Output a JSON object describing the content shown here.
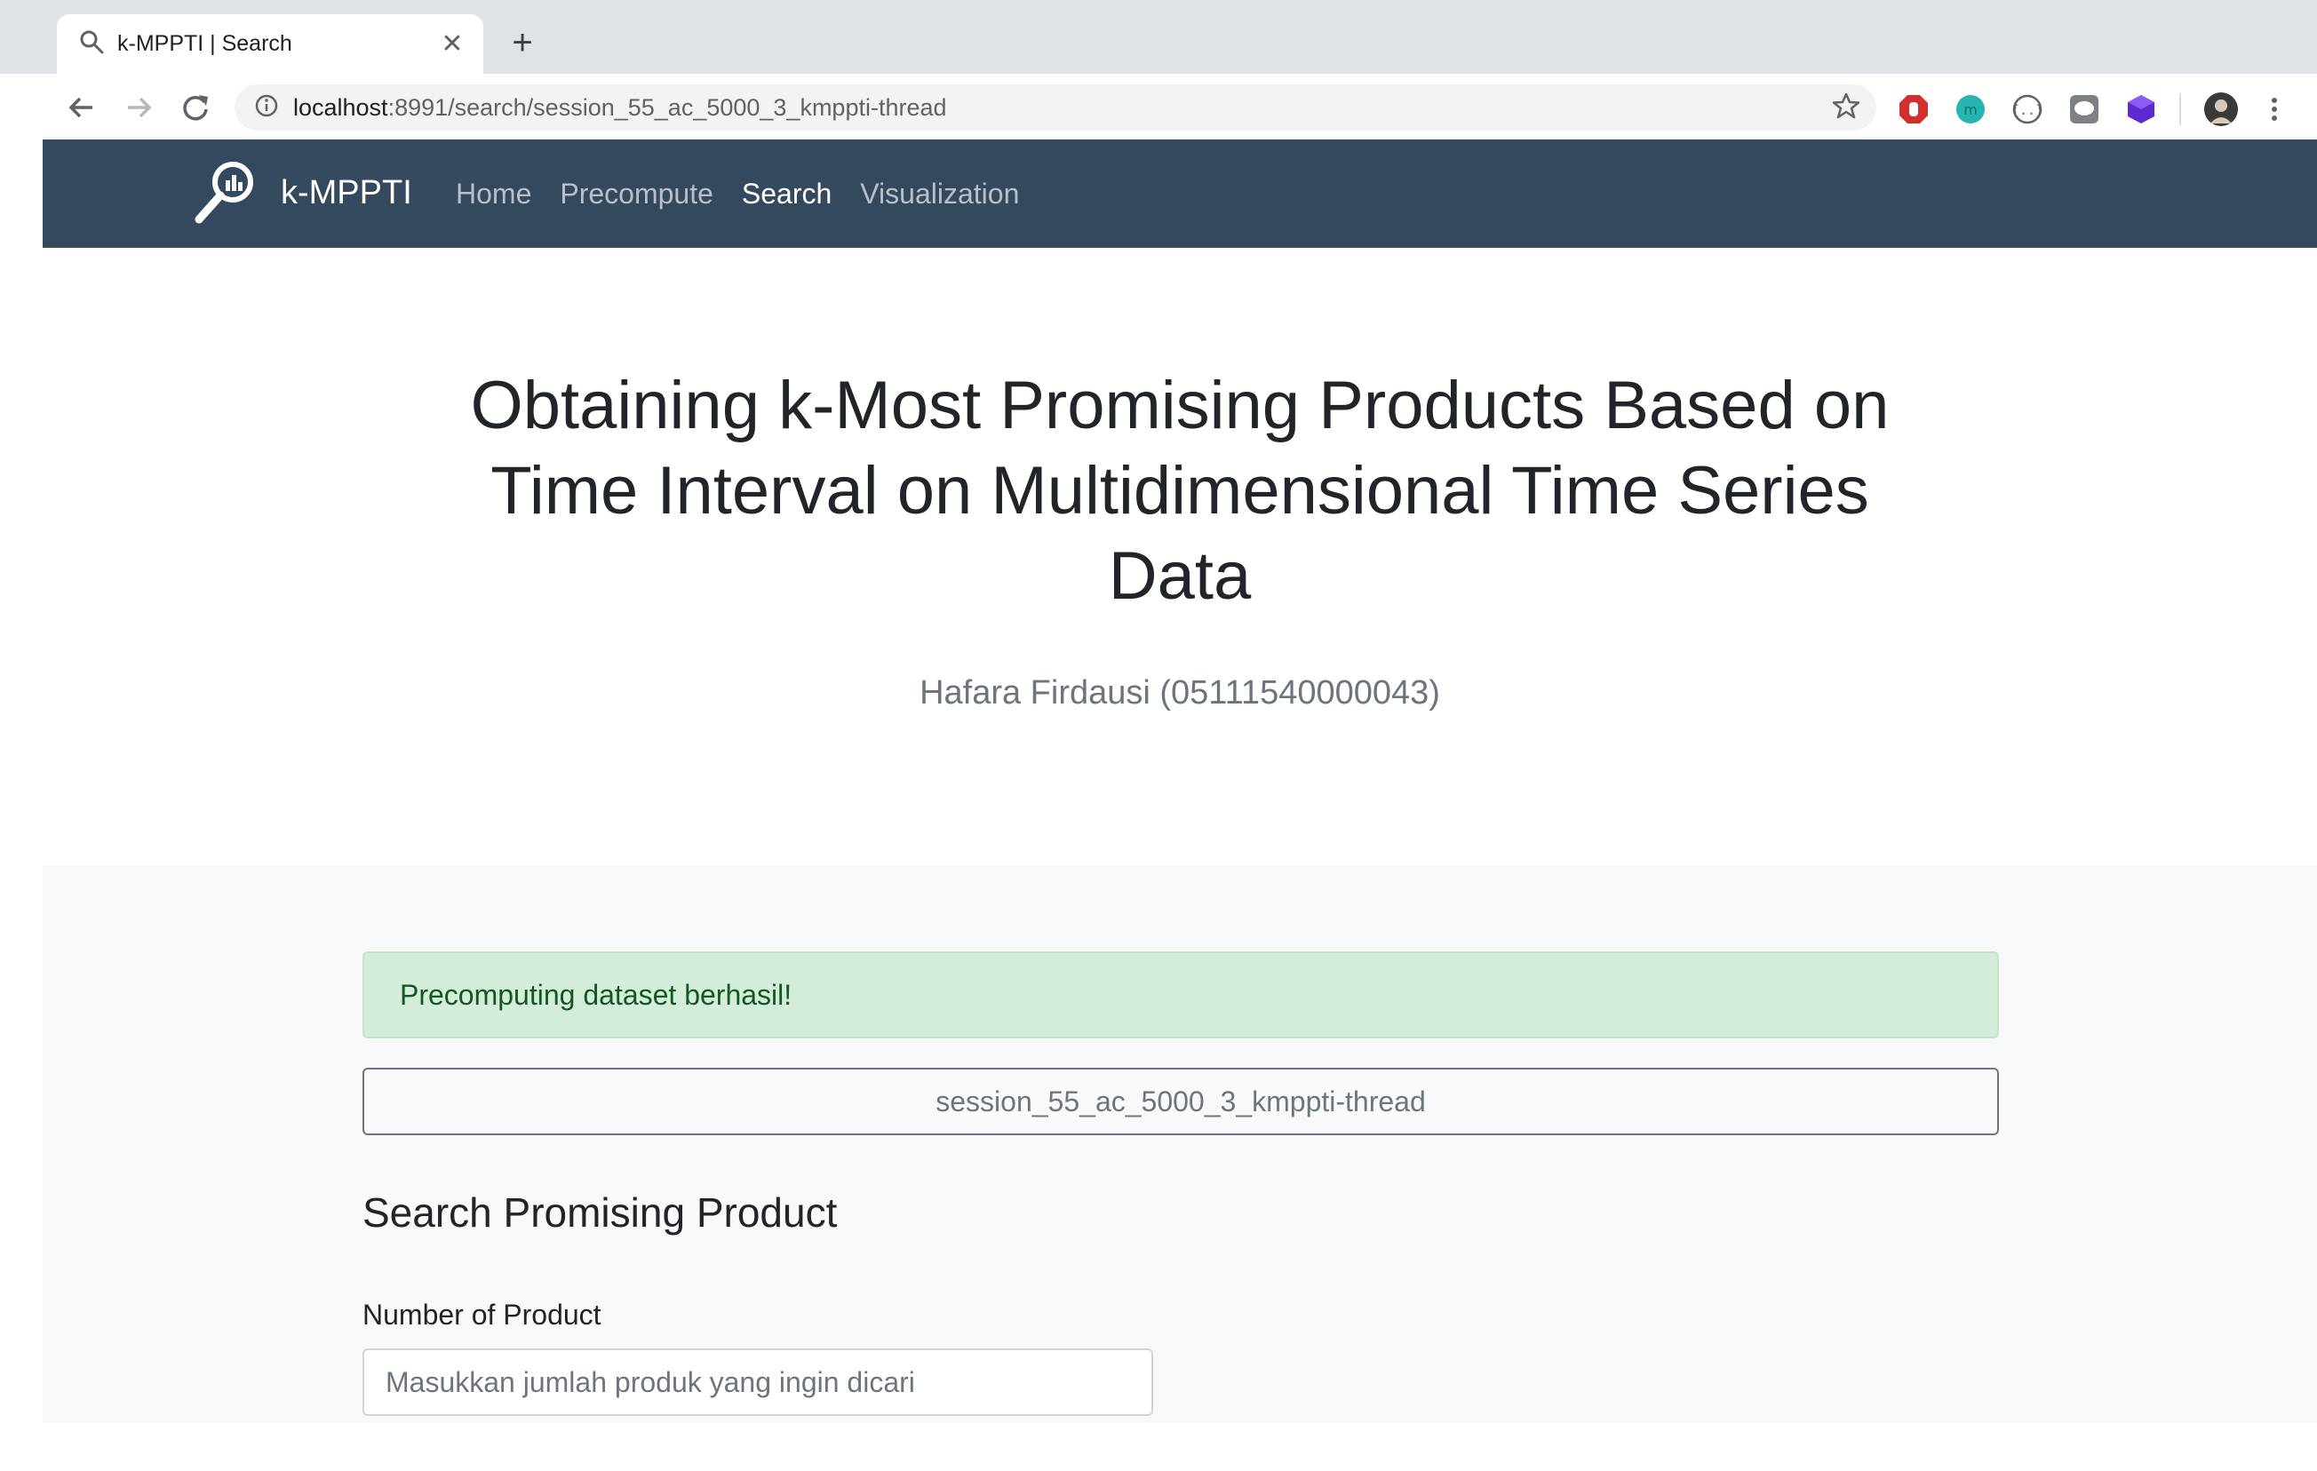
{
  "browser": {
    "tab_title": "k-MPPTI | Search",
    "url_host": "localhost",
    "url_rest": ":8991/search/session_55_ac_5000_3_kmppti-thread"
  },
  "navbar": {
    "brand": "k-MPPTI",
    "links": [
      {
        "label": "Home",
        "active": false
      },
      {
        "label": "Precompute",
        "active": false
      },
      {
        "label": "Search",
        "active": true
      },
      {
        "label": "Visualization",
        "active": false
      }
    ]
  },
  "hero": {
    "title": "Obtaining k-Most Promising Products Based on Time Interval on Multidimensional Time Series Data",
    "subtitle": "Hafara Firdausi (05111540000043)"
  },
  "main": {
    "alert": "Precomputing dataset berhasil!",
    "dataset_button": "session_55_ac_5000_3_kmppti-thread",
    "section_title": "Search Promising Product",
    "number_label": "Number of Product",
    "number_placeholder": "Masukkan jumlah produk yang ingin dicari"
  },
  "colors": {
    "navbar_bg": "#34495e",
    "alert_bg": "#d4edda",
    "alert_text": "#155724",
    "section_bg": "#f8f9fa"
  },
  "icons": {
    "tab": "search-icon",
    "extensions": [
      "adblock-icon",
      "teal-circle-extension-icon",
      "braces-extension-icon",
      "line-extension-icon",
      "purple-cube-extension-icon",
      "profile-avatar"
    ],
    "brand": "magnifier-chart-logo"
  }
}
